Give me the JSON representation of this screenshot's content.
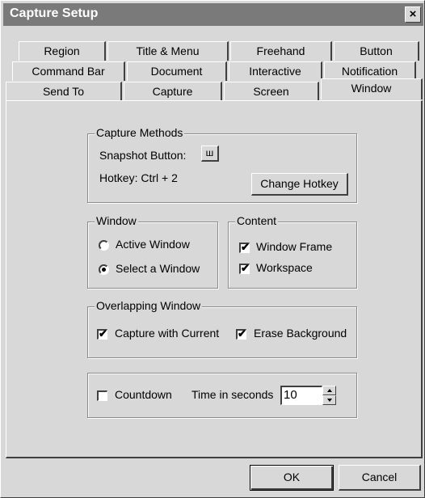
{
  "window": {
    "title": "Capture Setup",
    "close_glyph": "×"
  },
  "tabs": {
    "row1": [
      "Region",
      "Title & Menu",
      "Freehand",
      "Button"
    ],
    "row2": [
      "Command Bar",
      "Document",
      "Interactive",
      "Notification"
    ],
    "row3": [
      "Send To",
      "Capture",
      "Screen",
      "Window"
    ],
    "active": "Window"
  },
  "capture_methods": {
    "legend": "Capture Methods",
    "snapshot_label": "Snapshot Button:",
    "snapshot_button_glyph": "ш",
    "hotkey_label": "Hotkey: Ctrl + 2",
    "change_hotkey_label": "Change Hotkey"
  },
  "window_group": {
    "legend": "Window",
    "options": [
      {
        "label": "Active Window",
        "selected": false
      },
      {
        "label": "Select a Window",
        "selected": true
      }
    ]
  },
  "content_group": {
    "legend": "Content",
    "items": [
      {
        "label": "Window Frame",
        "checked": true
      },
      {
        "label": "Workspace",
        "checked": true
      }
    ]
  },
  "overlapping_group": {
    "legend": "Overlapping Window",
    "items": [
      {
        "label": "Capture with Current",
        "checked": true
      },
      {
        "label": "Erase Background",
        "checked": true
      }
    ]
  },
  "countdown": {
    "label": "Countdown",
    "checked": false,
    "time_label": "Time in seconds",
    "value": "10"
  },
  "buttons": {
    "ok": "OK",
    "cancel": "Cancel"
  },
  "check_glyph": "✔"
}
